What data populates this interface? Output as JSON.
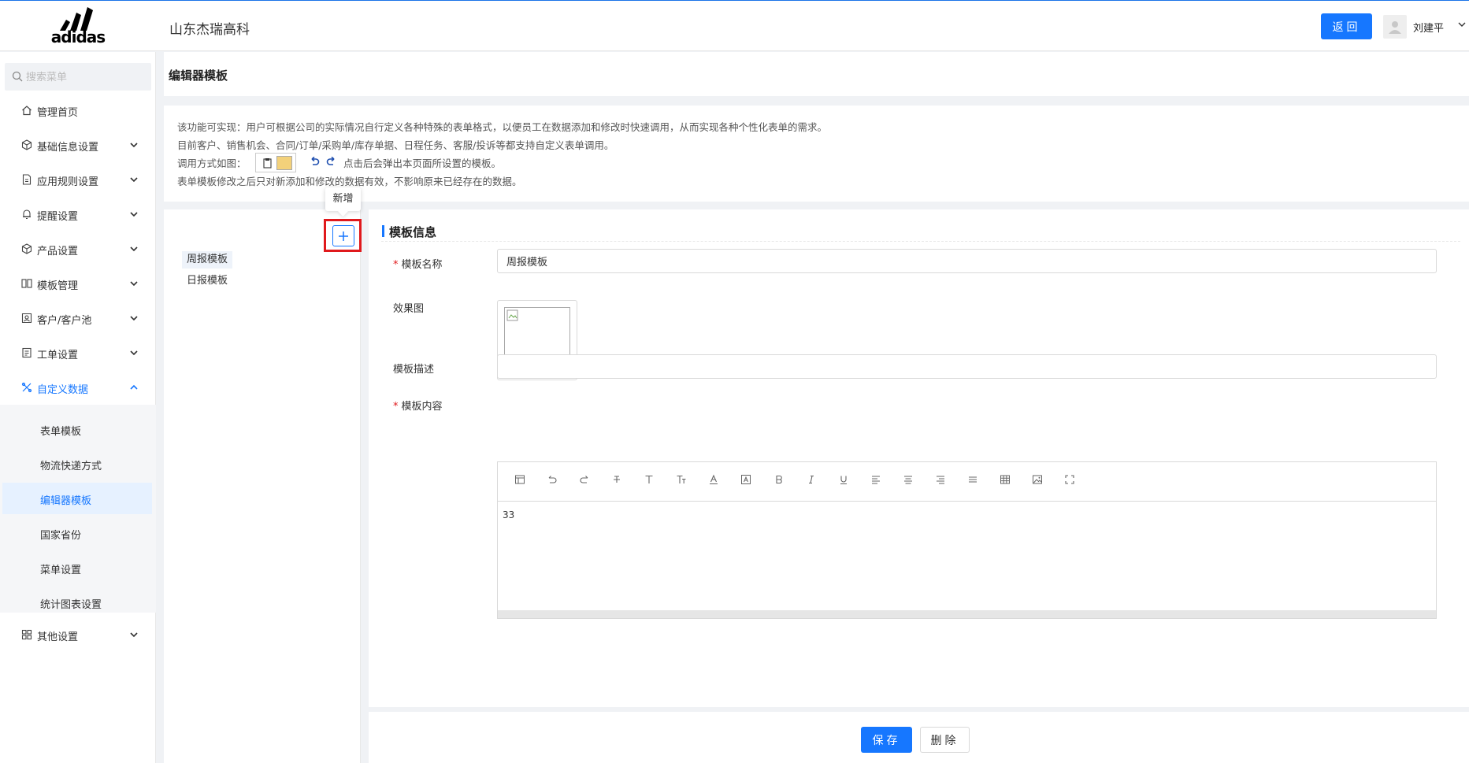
{
  "header": {
    "logo_text": "adidas",
    "company": "山东杰瑞高科",
    "return_label": "返回",
    "username": "刘建平"
  },
  "sidebar": {
    "search_placeholder": "搜索菜单",
    "items": [
      {
        "label": "管理首页",
        "icon": "home-icon"
      },
      {
        "label": "基础信息设置",
        "icon": "cube-icon"
      },
      {
        "label": "应用规则设置",
        "icon": "file-icon"
      },
      {
        "label": "提醒设置",
        "icon": "bell-icon"
      },
      {
        "label": "产品设置",
        "icon": "cube-icon"
      },
      {
        "label": "模板管理",
        "icon": "columns-icon"
      },
      {
        "label": "客户/客户池",
        "icon": "contacts-icon"
      },
      {
        "label": "工单设置",
        "icon": "ticket-icon"
      },
      {
        "label": "自定义数据",
        "icon": "tools-icon"
      },
      {
        "label": "其他设置",
        "icon": "apps-icon"
      }
    ],
    "submenu": [
      {
        "label": "表单模板"
      },
      {
        "label": "物流快递方式"
      },
      {
        "label": "编辑器模板"
      },
      {
        "label": "国家省份"
      },
      {
        "label": "菜单设置"
      },
      {
        "label": "统计图表设置"
      }
    ]
  },
  "page": {
    "title": "编辑器模板"
  },
  "info": {
    "line1": "该功能可实现：用户可根据公司的实际情况自行定义各种特殊的表单格式，以便员工在数据添加和修改时快速调用，从而实现各种个性化表单的需求。",
    "line2": "目前客户、销售机会、合同/订单/采购单/库存单据、日程任务、客服/投诉等都支持自定义表单调用。",
    "line3_prefix": "调用方式如图：",
    "line3_suffix": "点击后会弹出本页面所设置的模板。",
    "line4": "表单模板修改之后只对新添加和修改的数据有效，不影响原来已经存在的数据。"
  },
  "list": {
    "tooltip": "新增",
    "items": [
      "周报模板",
      "日报模板"
    ]
  },
  "form": {
    "section_title": "模板信息",
    "name_label": "模板名称",
    "name_value": "周报模板",
    "image_label": "效果图",
    "desc_label": "模板描述",
    "desc_value": "",
    "content_label": "模板内容",
    "content_value": "33",
    "toolbar_icons": [
      "template-icon",
      "undo-icon",
      "redo-icon",
      "strikethrough-icon",
      "heading-icon",
      "font-size-icon",
      "font-color-icon",
      "background-color-icon",
      "bold-icon",
      "italic-icon",
      "underline-icon",
      "align-left-icon",
      "align-center-icon",
      "align-right-icon",
      "justify-icon",
      "table-icon",
      "image-icon",
      "fullscreen-icon"
    ]
  },
  "footer": {
    "save_label": "保存",
    "delete_label": "删除"
  },
  "colors": {
    "accent": "#1677ff",
    "highlight_red": "#e0191c"
  }
}
